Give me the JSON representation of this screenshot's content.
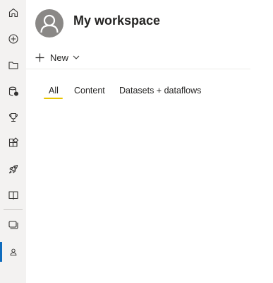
{
  "workspace": {
    "title": "My workspace",
    "avatar_icon": "person-avatar-icon"
  },
  "toolbar": {
    "new_label": "New"
  },
  "tabs": [
    {
      "label": "All",
      "selected": true
    },
    {
      "label": "Content",
      "selected": false
    },
    {
      "label": "Datasets + dataflows",
      "selected": false
    }
  ],
  "nav_rail": {
    "items": [
      {
        "icon": "home-icon"
      },
      {
        "icon": "create-icon"
      },
      {
        "icon": "browse-folder-icon"
      },
      {
        "icon": "data-hub-icon"
      },
      {
        "icon": "metrics-trophy-icon"
      },
      {
        "icon": "apps-icon"
      },
      {
        "icon": "deployment-rocket-icon"
      },
      {
        "icon": "learn-book-icon"
      },
      {
        "icon": "workspaces-icon"
      },
      {
        "icon": "my-workspace-icon",
        "active": true
      }
    ]
  },
  "colors": {
    "rail_bg": "#f3f2f1",
    "accent_underline": "#e8c400",
    "active_indicator": "#0f6cbd"
  }
}
